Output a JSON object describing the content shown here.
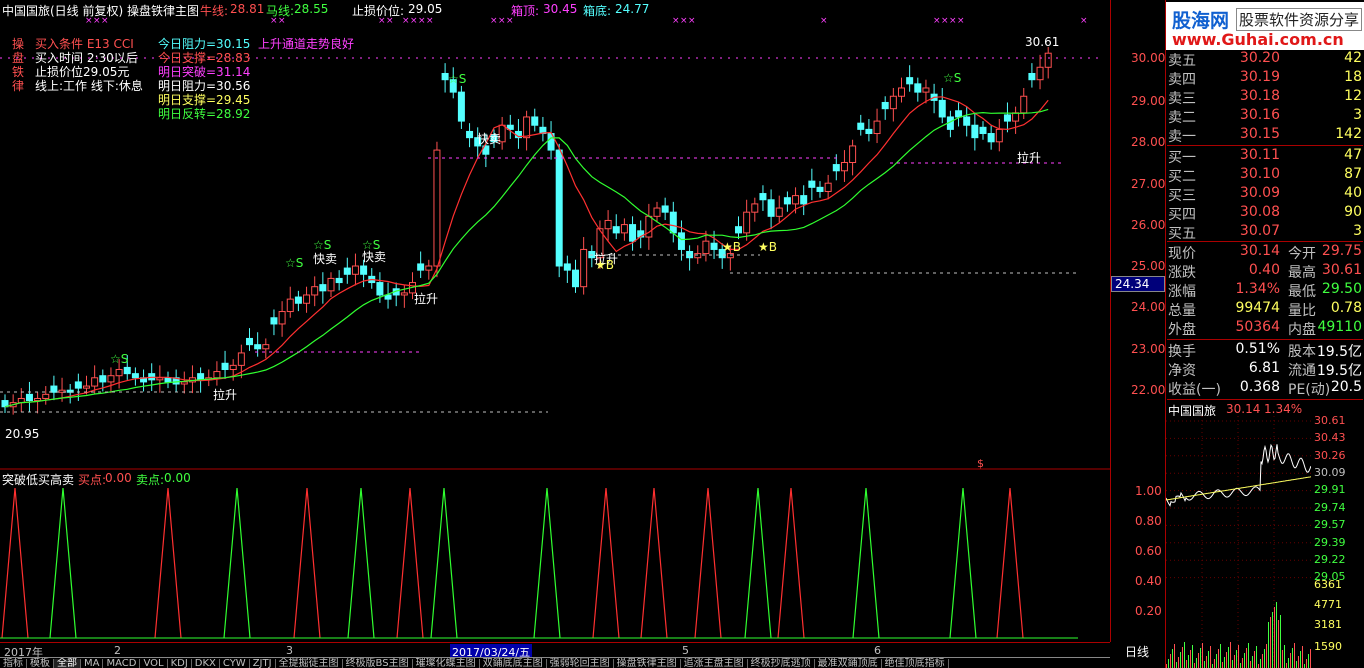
{
  "header": {
    "title": "中国国旅(日线 前复权) 操盘铁律主图",
    "niu_label": "牛线:",
    "niu_value": "28.81",
    "ma_label": "马线:",
    "ma_value": "28.55",
    "stop_label": "止损价位:",
    "stop_value": "29.05",
    "box_top_label": "箱顶:",
    "box_top_value": "30.45",
    "box_bottom_label": "箱底:",
    "box_bottom_value": "24.77"
  },
  "rules": {
    "side_chars": [
      "操",
      "盘",
      "铁",
      "律"
    ],
    "lines": [
      "买入条件 E13 CCI",
      "买入时间 2:30以后",
      "止损价位29.05元",
      "线上:工作 线下:休息"
    ]
  },
  "levels": {
    "lines": [
      "今日阻力=30.15",
      "今日支撑=28.83",
      "明日突破=31.14",
      "明日阻力=30.56",
      "明日支撑=29.45",
      "明日反转=28.92"
    ],
    "trend_note": "上升通道走势良好"
  },
  "annotations": {
    "high_mark": "30.61",
    "low_mark": "20.95",
    "sell_fast": "快卖",
    "lift": "拉升",
    "s_mark": "☆S",
    "b_mark": "★B",
    "dollar": "$"
  },
  "price_axis": {
    "ticks": [
      "30.00",
      "29.00",
      "28.00",
      "27.00",
      "26.00",
      "25.00",
      "24.00",
      "23.00",
      "22.00"
    ],
    "cursor_value": "24.34"
  },
  "sub_indicator": {
    "name": "突破低买高卖",
    "buy_label": "买点:",
    "buy_value": "0.00",
    "sell_label": "卖点:",
    "sell_value": "0.00",
    "ticks": [
      "1.00",
      "0.80",
      "0.60",
      "0.40",
      "0.20"
    ]
  },
  "date_axis": {
    "labels": [
      "2017年",
      "2",
      "3",
      "2017/03/24/五",
      "5",
      "6"
    ],
    "period": "日线"
  },
  "tabs": [
    "指标",
    "模板",
    "全部",
    "MA",
    "MACD",
    "VOL",
    "KDJ",
    "DKX",
    "CYW",
    "ZJTJ",
    "全提掘徒主图",
    "终极版BS主图",
    "璀璨化蝶主图",
    "双鋪底底主图",
    "强弱轮回主图",
    "操盘铁律主图",
    "追涨主盘主图",
    "终极抄底逃顶",
    "最准双鋪顶底",
    "绝佳顶底指标"
  ],
  "active_tab": "全部",
  "logo": {
    "brand": "股海网",
    "slogan": "股票软件资源分享",
    "url": "www.Guhai.com.cn"
  },
  "order_book": {
    "sells": [
      {
        "label": "卖五",
        "price": "30.20",
        "vol": "42"
      },
      {
        "label": "卖四",
        "price": "30.19",
        "vol": "18"
      },
      {
        "label": "卖三",
        "price": "30.18",
        "vol": "12"
      },
      {
        "label": "卖二",
        "price": "30.16",
        "vol": "3"
      },
      {
        "label": "卖一",
        "price": "30.15",
        "vol": "142"
      }
    ],
    "buys": [
      {
        "label": "买一",
        "price": "30.11",
        "vol": "47"
      },
      {
        "label": "买二",
        "price": "30.10",
        "vol": "87"
      },
      {
        "label": "买三",
        "price": "30.09",
        "vol": "40"
      },
      {
        "label": "买四",
        "price": "30.08",
        "vol": "90"
      },
      {
        "label": "买五",
        "price": "30.07",
        "vol": "3"
      }
    ]
  },
  "quote": [
    {
      "l1": "现价",
      "v1": "30.14",
      "l2": "今开",
      "v2": "29.75",
      "c1": "red",
      "c2": "red"
    },
    {
      "l1": "涨跌",
      "v1": "0.40",
      "l2": "最高",
      "v2": "30.61",
      "c1": "red",
      "c2": "red"
    },
    {
      "l1": "涨幅",
      "v1": "1.34%",
      "l2": "最低",
      "v2": "29.50",
      "c1": "red",
      "c2": "green"
    },
    {
      "l1": "总量",
      "v1": "99474",
      "l2": "量比",
      "v2": "0.78",
      "c1": "yellow",
      "c2": "yellow"
    },
    {
      "l1": "外盘",
      "v1": "50364",
      "l2": "内盘",
      "v2": "49110",
      "c1": "red",
      "c2": "green"
    }
  ],
  "fundamentals": [
    {
      "l1": "换手",
      "v1": "0.51%",
      "l2": "股本",
      "v2": "19.5亿"
    },
    {
      "l1": "净资",
      "v1": "6.81",
      "l2": "流通",
      "v2": "19.5亿"
    },
    {
      "l1": "收益(一)",
      "v1": "0.368",
      "l2": "PE(动)",
      "v2": "20.5"
    }
  ],
  "mini_chart": {
    "name": "中国国旅",
    "price": "30.14",
    "change": "1.34%",
    "ticks": [
      "30.61",
      "30.43",
      "30.26",
      "30.09",
      "29.91",
      "29.74",
      "29.57",
      "29.39",
      "29.22",
      "29.05",
      "6361",
      "4771",
      "3181",
      "1590"
    ]
  },
  "colors": {
    "up": "#ff5050",
    "down": "#54ffff",
    "ma_fast": "#ff3030",
    "ma_slow": "#30ff30",
    "dashed": "#ff00ff"
  }
}
